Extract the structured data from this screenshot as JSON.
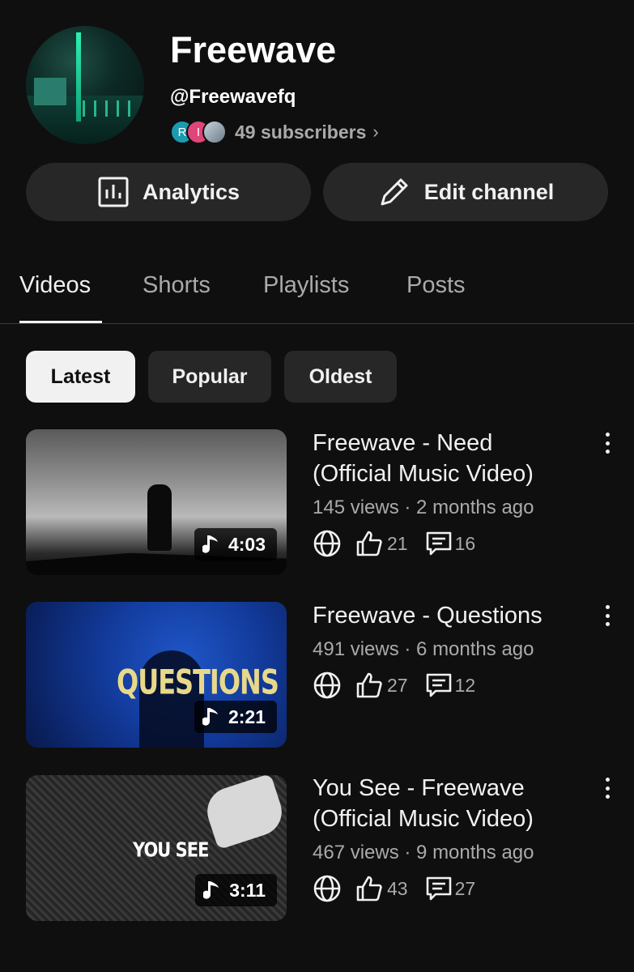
{
  "channel": {
    "name": "Freewave",
    "handle": "@Freewavefq",
    "subscriber_avatars": [
      "R",
      "I",
      ""
    ],
    "subscribers": "49 subscribers",
    "subscribers_chevron": "›"
  },
  "actions": {
    "analytics_label": "Analytics",
    "edit_label": "Edit channel"
  },
  "tabs": [
    {
      "label": "Videos",
      "active": true
    },
    {
      "label": "Shorts",
      "active": false
    },
    {
      "label": "Playlists",
      "active": false
    },
    {
      "label": "Posts",
      "active": false
    }
  ],
  "filters": [
    {
      "label": "Latest",
      "selected": true
    },
    {
      "label": "Popular",
      "selected": false
    },
    {
      "label": "Oldest",
      "selected": false
    }
  ],
  "videos": [
    {
      "title_line1": "Freewave - Need",
      "title_line2": "(Official Music Video)",
      "meta": "145 views · 2 months ago",
      "duration": "4:03",
      "likes": "21",
      "comments": "16",
      "thumb_text": ""
    },
    {
      "title_line1": "Freewave - Questions",
      "title_line2": "",
      "meta": "491 views · 6 months ago",
      "duration": "2:21",
      "likes": "27",
      "comments": "12",
      "thumb_text": "QUESTIONS"
    },
    {
      "title_line1": "You See - Freewave",
      "title_line2": "(Official Music Video)",
      "meta": "467 views · 9 months ago",
      "duration": "3:11",
      "likes": "43",
      "comments": "27",
      "thumb_text": "YOU SEE"
    }
  ],
  "icons": {
    "visibility": "globe-icon",
    "like": "thumbs-up-icon",
    "comment": "comment-icon",
    "menu": "more-vertical-icon",
    "duration": "music-note-icon"
  },
  "colors": {
    "background": "#0f0f0f",
    "chip_selected": "#f1f1f1",
    "button_bg": "#272727",
    "secondary_text": "#aaaaaa"
  }
}
